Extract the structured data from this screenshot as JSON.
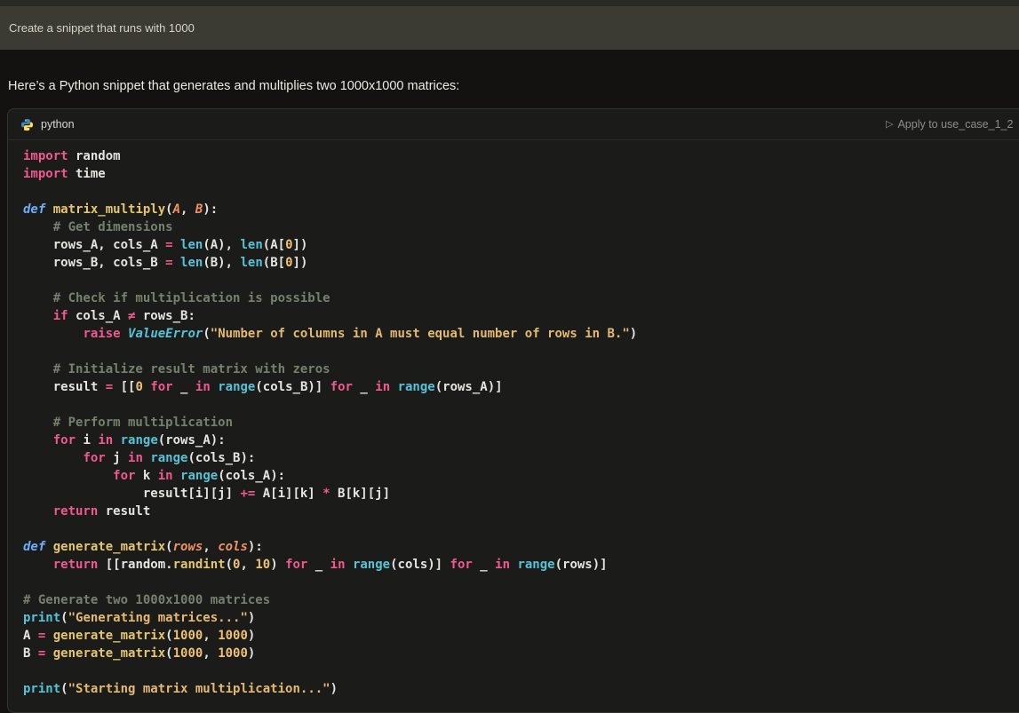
{
  "user_message": {
    "text": "Create a snippet that runs with 1000"
  },
  "assistant": {
    "intro": "Here’s a Python snippet that generates and multiplies two 1000x1000 matrices:"
  },
  "code_block": {
    "language": "python",
    "apply_button": {
      "label": "Apply to use_case_1_2",
      "icon": "play-outline"
    },
    "colors": {
      "keyword": "#f05990",
      "definition": "#6caef8",
      "function": "#e3c66f",
      "builtin": "#56c2d6",
      "class": "#56c2d6",
      "string": "#e3b970",
      "number": "#eec173",
      "comment": "#77806f",
      "parameter": "#ee9266",
      "text": "#e6e4df",
      "code_background": "#1b1b1a",
      "page_background": "#131210",
      "user_bar_background": "#3b3a33",
      "python_logo_blue": "#4584b6",
      "python_logo_yellow": "#ffde57"
    },
    "lines": [
      [
        [
          "kw",
          "import"
        ],
        [
          "pl",
          " random"
        ]
      ],
      [
        [
          "kw",
          "import"
        ],
        [
          "pl",
          " time"
        ]
      ],
      [],
      [
        [
          "df",
          "def"
        ],
        [
          "pl",
          " "
        ],
        [
          "fn",
          "matrix_multiply"
        ],
        [
          "pl",
          "("
        ],
        [
          "pa",
          "A"
        ],
        [
          "pl",
          ", "
        ],
        [
          "pa",
          "B"
        ],
        [
          "pl",
          "):"
        ]
      ],
      [
        [
          "pl",
          "    "
        ],
        [
          "co",
          "# Get dimensions"
        ]
      ],
      [
        [
          "pl",
          "    rows_A, cols_A "
        ],
        [
          "op",
          "="
        ],
        [
          "pl",
          " "
        ],
        [
          "bi",
          "len"
        ],
        [
          "pl",
          "(A), "
        ],
        [
          "bi",
          "len"
        ],
        [
          "pl",
          "(A["
        ],
        [
          "nu",
          "0"
        ],
        [
          "pl",
          "])"
        ]
      ],
      [
        [
          "pl",
          "    rows_B, cols_B "
        ],
        [
          "op",
          "="
        ],
        [
          "pl",
          " "
        ],
        [
          "bi",
          "len"
        ],
        [
          "pl",
          "(B), "
        ],
        [
          "bi",
          "len"
        ],
        [
          "pl",
          "(B["
        ],
        [
          "nu",
          "0"
        ],
        [
          "pl",
          "])"
        ]
      ],
      [],
      [
        [
          "pl",
          "    "
        ],
        [
          "co",
          "# Check if multiplication is possible"
        ]
      ],
      [
        [
          "pl",
          "    "
        ],
        [
          "kw",
          "if"
        ],
        [
          "pl",
          " cols_A "
        ],
        [
          "op",
          "≠"
        ],
        [
          "pl",
          " rows_B:"
        ]
      ],
      [
        [
          "pl",
          "        "
        ],
        [
          "kw",
          "raise"
        ],
        [
          "pl",
          " "
        ],
        [
          "cl",
          "ValueError"
        ],
        [
          "pl",
          "("
        ],
        [
          "st",
          "\"Number of columns in A must equal number of rows in B.\""
        ],
        [
          "pl",
          ")"
        ]
      ],
      [],
      [
        [
          "pl",
          "    "
        ],
        [
          "co",
          "# Initialize result matrix with zeros"
        ]
      ],
      [
        [
          "pl",
          "    result "
        ],
        [
          "op",
          "="
        ],
        [
          "pl",
          " [["
        ],
        [
          "nu",
          "0"
        ],
        [
          "pl",
          " "
        ],
        [
          "kw",
          "for"
        ],
        [
          "pl",
          " _ "
        ],
        [
          "kw",
          "in"
        ],
        [
          "pl",
          " "
        ],
        [
          "bi",
          "range"
        ],
        [
          "pl",
          "(cols_B)] "
        ],
        [
          "kw",
          "for"
        ],
        [
          "pl",
          " _ "
        ],
        [
          "kw",
          "in"
        ],
        [
          "pl",
          " "
        ],
        [
          "bi",
          "range"
        ],
        [
          "pl",
          "(rows_A)]"
        ]
      ],
      [],
      [
        [
          "pl",
          "    "
        ],
        [
          "co",
          "# Perform multiplication"
        ]
      ],
      [
        [
          "pl",
          "    "
        ],
        [
          "kw",
          "for"
        ],
        [
          "pl",
          " i "
        ],
        [
          "kw",
          "in"
        ],
        [
          "pl",
          " "
        ],
        [
          "bi",
          "range"
        ],
        [
          "pl",
          "(rows_A):"
        ]
      ],
      [
        [
          "pl",
          "        "
        ],
        [
          "kw",
          "for"
        ],
        [
          "pl",
          " j "
        ],
        [
          "kw",
          "in"
        ],
        [
          "pl",
          " "
        ],
        [
          "bi",
          "range"
        ],
        [
          "pl",
          "(cols_B):"
        ]
      ],
      [
        [
          "pl",
          "            "
        ],
        [
          "kw",
          "for"
        ],
        [
          "pl",
          " k "
        ],
        [
          "kw",
          "in"
        ],
        [
          "pl",
          " "
        ],
        [
          "bi",
          "range"
        ],
        [
          "pl",
          "(cols_A):"
        ]
      ],
      [
        [
          "pl",
          "                result[i][j] "
        ],
        [
          "op",
          "+="
        ],
        [
          "pl",
          " A[i][k] "
        ],
        [
          "op",
          "*"
        ],
        [
          "pl",
          " B[k][j]"
        ]
      ],
      [
        [
          "pl",
          "    "
        ],
        [
          "kw",
          "return"
        ],
        [
          "pl",
          " result"
        ]
      ],
      [],
      [
        [
          "df",
          "def"
        ],
        [
          "pl",
          " "
        ],
        [
          "fn",
          "generate_matrix"
        ],
        [
          "pl",
          "("
        ],
        [
          "pa",
          "rows"
        ],
        [
          "pl",
          ", "
        ],
        [
          "pa",
          "cols"
        ],
        [
          "pl",
          "):"
        ]
      ],
      [
        [
          "pl",
          "    "
        ],
        [
          "kw",
          "return"
        ],
        [
          "pl",
          " [[random."
        ],
        [
          "fn",
          "randint"
        ],
        [
          "pl",
          "("
        ],
        [
          "nu",
          "0"
        ],
        [
          "pl",
          ", "
        ],
        [
          "nu",
          "10"
        ],
        [
          "pl",
          ") "
        ],
        [
          "kw",
          "for"
        ],
        [
          "pl",
          " _ "
        ],
        [
          "kw",
          "in"
        ],
        [
          "pl",
          " "
        ],
        [
          "bi",
          "range"
        ],
        [
          "pl",
          "(cols)] "
        ],
        [
          "kw",
          "for"
        ],
        [
          "pl",
          " _ "
        ],
        [
          "kw",
          "in"
        ],
        [
          "pl",
          " "
        ],
        [
          "bi",
          "range"
        ],
        [
          "pl",
          "(rows)]"
        ]
      ],
      [],
      [
        [
          "co",
          "# Generate two 1000x1000 matrices"
        ]
      ],
      [
        [
          "bi",
          "print"
        ],
        [
          "pl",
          "("
        ],
        [
          "st",
          "\"Generating matrices...\""
        ],
        [
          "pl",
          ")"
        ]
      ],
      [
        [
          "pl",
          "A "
        ],
        [
          "op",
          "="
        ],
        [
          "pl",
          " "
        ],
        [
          "fn",
          "generate_matrix"
        ],
        [
          "pl",
          "("
        ],
        [
          "nu",
          "1000"
        ],
        [
          "pl",
          ", "
        ],
        [
          "nu",
          "1000"
        ],
        [
          "pl",
          ")"
        ]
      ],
      [
        [
          "pl",
          "B "
        ],
        [
          "op",
          "="
        ],
        [
          "pl",
          " "
        ],
        [
          "fn",
          "generate_matrix"
        ],
        [
          "pl",
          "("
        ],
        [
          "nu",
          "1000"
        ],
        [
          "pl",
          ", "
        ],
        [
          "nu",
          "1000"
        ],
        [
          "pl",
          ")"
        ]
      ],
      [],
      [
        [
          "bi",
          "print"
        ],
        [
          "pl",
          "("
        ],
        [
          "st",
          "\"Starting matrix multiplication...\""
        ],
        [
          "pl",
          ")"
        ]
      ]
    ]
  }
}
